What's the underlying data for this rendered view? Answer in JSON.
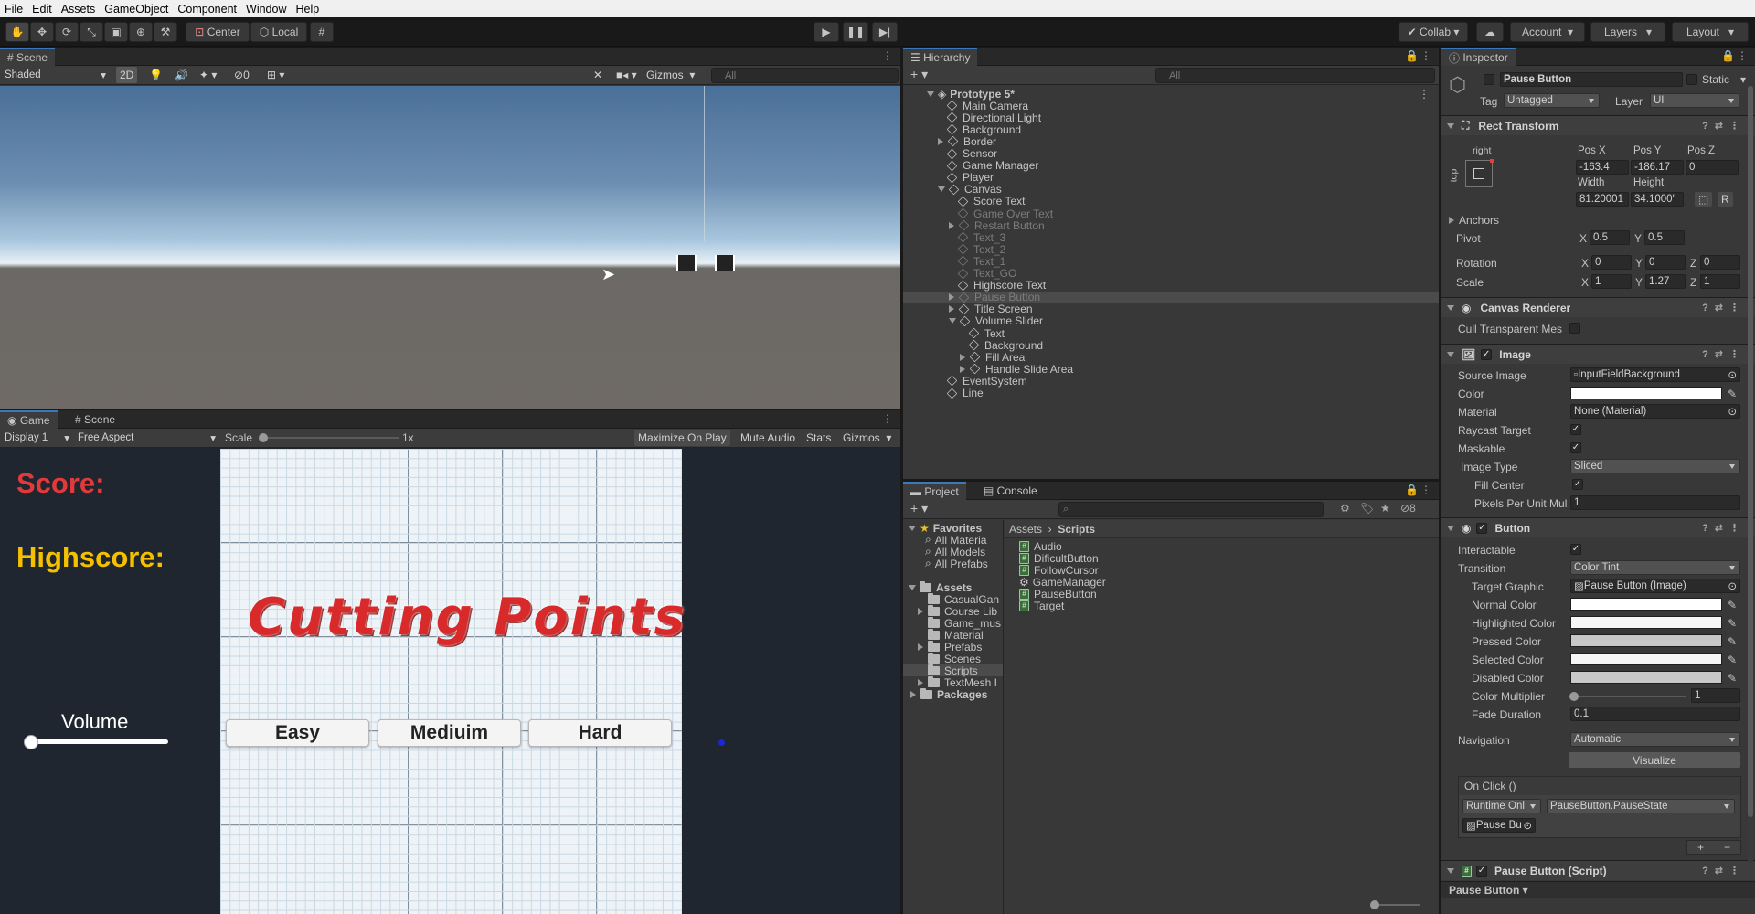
{
  "menu": [
    "File",
    "Edit",
    "Assets",
    "GameObject",
    "Component",
    "Window",
    "Help"
  ],
  "toolbar": {
    "pivot": "Center",
    "space": "Local",
    "collab": "Collab",
    "account": "Account",
    "layers": "Layers",
    "layout": "Layout"
  },
  "scene": {
    "tab": "Scene",
    "shading": "Shaded",
    "mode2d": "2D",
    "hidden_count": "0",
    "gizmos": "Gizmos",
    "search": "All"
  },
  "game": {
    "tab_game": "Game",
    "tab_scene": "Scene",
    "display": "Display 1",
    "aspect": "Free Aspect",
    "scale_label": "Scale",
    "scale_value": "1x",
    "maximize": "Maximize On Play",
    "mute": "Mute Audio",
    "stats": "Stats",
    "gizmos": "Gizmos",
    "score_label": "Score:",
    "highscore_label": "Highscore:",
    "title": "Cutting Points",
    "volume_label": "Volume",
    "buttons": [
      "Easy",
      "Mediuim",
      "Hard"
    ],
    "score_color": "#e23a3a",
    "highscore_color": "#f5c000"
  },
  "hierarchy": {
    "tab": "Hierarchy",
    "search": "All",
    "items": [
      {
        "label": "Prototype 5*",
        "depth": 0,
        "expand": "open",
        "dim": false,
        "sel": false
      },
      {
        "label": "Main Camera",
        "depth": 1,
        "expand": "",
        "dim": false,
        "sel": false
      },
      {
        "label": "Directional Light",
        "depth": 1,
        "expand": "",
        "dim": false,
        "sel": false
      },
      {
        "label": "Background",
        "depth": 1,
        "expand": "",
        "dim": false,
        "sel": false
      },
      {
        "label": "Border",
        "depth": 1,
        "expand": "closed",
        "dim": false,
        "sel": false
      },
      {
        "label": "Sensor",
        "depth": 1,
        "expand": "",
        "dim": false,
        "sel": false
      },
      {
        "label": "Game Manager",
        "depth": 1,
        "expand": "",
        "dim": false,
        "sel": false
      },
      {
        "label": "Player",
        "depth": 1,
        "expand": "",
        "dim": false,
        "sel": false
      },
      {
        "label": "Canvas",
        "depth": 1,
        "expand": "open",
        "dim": false,
        "sel": false
      },
      {
        "label": "Score Text",
        "depth": 2,
        "expand": "",
        "dim": false,
        "sel": false
      },
      {
        "label": "Game Over Text",
        "depth": 2,
        "expand": "",
        "dim": true,
        "sel": false
      },
      {
        "label": "Restart Button",
        "depth": 2,
        "expand": "closed",
        "dim": true,
        "sel": false
      },
      {
        "label": "Text_3",
        "depth": 2,
        "expand": "",
        "dim": true,
        "sel": false
      },
      {
        "label": "Text_2",
        "depth": 2,
        "expand": "",
        "dim": true,
        "sel": false
      },
      {
        "label": "Text_1",
        "depth": 2,
        "expand": "",
        "dim": true,
        "sel": false
      },
      {
        "label": "Text_GO",
        "depth": 2,
        "expand": "",
        "dim": true,
        "sel": false
      },
      {
        "label": "Highscore Text",
        "depth": 2,
        "expand": "",
        "dim": false,
        "sel": false
      },
      {
        "label": "Pause Button",
        "depth": 2,
        "expand": "closed",
        "dim": true,
        "sel": true
      },
      {
        "label": "Title Screen",
        "depth": 2,
        "expand": "closed",
        "dim": false,
        "sel": false
      },
      {
        "label": "Volume Slider",
        "depth": 2,
        "expand": "open",
        "dim": false,
        "sel": false
      },
      {
        "label": "Text",
        "depth": 3,
        "expand": "",
        "dim": false,
        "sel": false
      },
      {
        "label": "Background",
        "depth": 3,
        "expand": "",
        "dim": false,
        "sel": false
      },
      {
        "label": "Fill Area",
        "depth": 3,
        "expand": "closed",
        "dim": false,
        "sel": false
      },
      {
        "label": "Handle Slide Area",
        "depth": 3,
        "expand": "closed",
        "dim": false,
        "sel": false
      },
      {
        "label": "EventSystem",
        "depth": 1,
        "expand": "",
        "dim": false,
        "sel": false
      },
      {
        "label": "Line",
        "depth": 1,
        "expand": "",
        "dim": false,
        "sel": false
      }
    ]
  },
  "project": {
    "tab_project": "Project",
    "tab_console": "Console",
    "hidden_count": "8",
    "favorites": "Favorites",
    "fav_items": [
      "All Materia",
      "All Models",
      "All Prefabs"
    ],
    "assets": "Assets",
    "asset_folders": [
      {
        "label": "CasualGan",
        "expand": ""
      },
      {
        "label": "Course Lib",
        "expand": "closed"
      },
      {
        "label": "Game_mus",
        "expand": ""
      },
      {
        "label": "Material",
        "expand": ""
      },
      {
        "label": "Prefabs",
        "expand": "closed"
      },
      {
        "label": "Scenes",
        "expand": ""
      },
      {
        "label": "Scripts",
        "expand": ""
      },
      {
        "label": "TextMesh I",
        "expand": "closed"
      }
    ],
    "packages": "Packages",
    "breadcrumb_root": "Assets",
    "breadcrumb_leaf": "Scripts",
    "files": [
      {
        "label": "Audio",
        "icon": "script"
      },
      {
        "label": "DificultButton",
        "icon": "script"
      },
      {
        "label": "FollowCursor",
        "icon": "script"
      },
      {
        "label": "GameManager",
        "icon": "gear"
      },
      {
        "label": "PauseButton",
        "icon": "script"
      },
      {
        "label": "Target",
        "icon": "script"
      }
    ]
  },
  "inspector": {
    "tab": "Inspector",
    "object_name": "Pause Button",
    "static": "Static",
    "tag_label": "Tag",
    "tag": "Untagged",
    "layer_label": "Layer",
    "layer": "UI",
    "rect": {
      "title": "Rect Transform",
      "anchor_h": "right",
      "anchor_v": "top",
      "posx_l": "Pos X",
      "posy_l": "Pos Y",
      "posz_l": "Pos Z",
      "posx": "-163.4",
      "posy": "-186.17",
      "posz": "0",
      "width_l": "Width",
      "height_l": "Height",
      "width": "81.20001",
      "height": "34.1000'",
      "r": "R",
      "anchors": "Anchors",
      "pivot": "Pivot",
      "pivot_x": "0.5",
      "pivot_y": "0.5",
      "rotation": "Rotation",
      "rot_x": "0",
      "rot_y": "0",
      "rot_z": "0",
      "scale": "Scale",
      "sc_x": "1",
      "sc_y": "1.27",
      "sc_z": "1",
      "x": "X",
      "y": "Y",
      "z": "Z"
    },
    "canvas": {
      "title": "Canvas Renderer",
      "cull": "Cull Transparent Mes"
    },
    "image": {
      "title": "Image",
      "source_l": "Source Image",
      "source": "InputFieldBackground",
      "color_l": "Color",
      "material_l": "Material",
      "material": "None (Material)",
      "raycast": "Raycast Target",
      "maskable": "Maskable",
      "type_l": "Image Type",
      "type": "Sliced",
      "fill": "Fill Center",
      "ppu": "Pixels Per Unit Mul",
      "ppu_v": "1"
    },
    "button": {
      "title": "Button",
      "interactable": "Interactable",
      "transition_l": "Transition",
      "transition": "Color Tint",
      "target_l": "Target Graphic",
      "target": "Pause Button (Image)",
      "normal": "Normal Color",
      "highlighted": "Highlighted Color",
      "pressed": "Pressed Color",
      "selected": "Selected Color",
      "disabled": "Disabled Color",
      "mult": "Color Multiplier",
      "mult_v": "1",
      "fade": "Fade Duration",
      "fade_v": "0.1",
      "nav_l": "Navigation",
      "nav": "Automatic",
      "visualize": "Visualize",
      "onclick": "On Click ()",
      "runtime": "Runtime Onl",
      "func": "PauseButton.PauseState",
      "obj": "Pause Bu",
      "plus": "+",
      "minus": "−"
    },
    "script": {
      "title": "Pause Button (Script)",
      "footer": "Pause Button"
    }
  }
}
